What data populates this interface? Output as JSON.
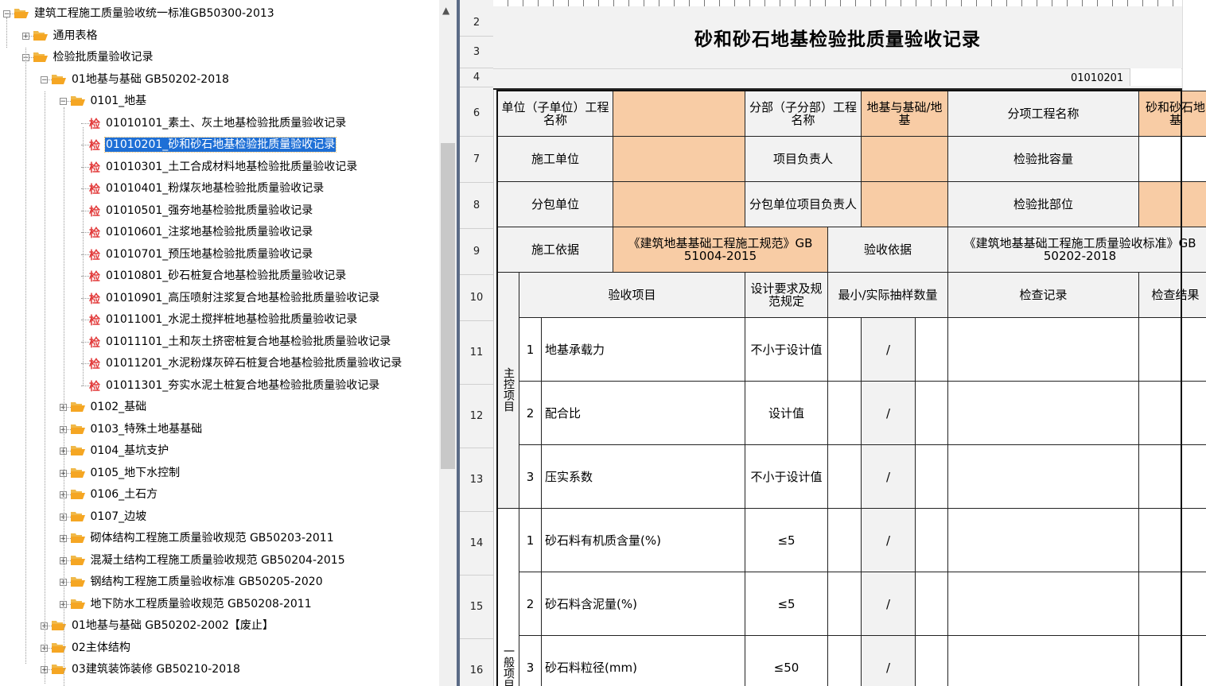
{
  "tree": {
    "items": [
      {
        "label": "建筑工程施工质量验收统一标准GB50300-2013",
        "type": "folder",
        "expander": "−"
      },
      {
        "label": "通用表格",
        "type": "folder",
        "expander": "+"
      },
      {
        "label": "检验批质量验收记录",
        "type": "folder",
        "expander": "−"
      },
      {
        "label": "01地基与基础 GB50202-2018",
        "type": "folder",
        "expander": "−"
      },
      {
        "label": "0101_地基",
        "type": "folder",
        "expander": "−"
      },
      {
        "label": "01010101_素土、灰土地基检验批质量验收记录",
        "type": "doc"
      },
      {
        "label": "01010201_砂和砂石地基检验批质量验收记录",
        "type": "doc",
        "selected": true
      },
      {
        "label": "01010301_土工合成材料地基检验批质量验收记录",
        "type": "doc"
      },
      {
        "label": "01010401_粉煤灰地基检验批质量验收记录",
        "type": "doc"
      },
      {
        "label": "01010501_强夯地基检验批质量验收记录",
        "type": "doc"
      },
      {
        "label": "01010601_注浆地基检验批质量验收记录",
        "type": "doc"
      },
      {
        "label": "01010701_预压地基检验批质量验收记录",
        "type": "doc"
      },
      {
        "label": "01010801_砂石桩复合地基检验批质量验收记录",
        "type": "doc"
      },
      {
        "label": "01010901_高压喷射注浆复合地基检验批质量验收记录",
        "type": "doc"
      },
      {
        "label": "01011001_水泥土搅拌桩地基检验批质量验收记录",
        "type": "doc"
      },
      {
        "label": "01011101_土和灰土挤密桩复合地基检验批质量验收记录",
        "type": "doc"
      },
      {
        "label": "01011201_水泥粉煤灰碎石桩复合地基检验批质量验收记录",
        "type": "doc"
      },
      {
        "label": "01011301_夯实水泥土桩复合地基检验批质量验收记录",
        "type": "doc"
      },
      {
        "label": "0102_基础",
        "type": "folder",
        "expander": "+"
      },
      {
        "label": "0103_特殊土地基基础",
        "type": "folder",
        "expander": "+"
      },
      {
        "label": "0104_基坑支护",
        "type": "folder",
        "expander": "+"
      },
      {
        "label": "0105_地下水控制",
        "type": "folder",
        "expander": "+"
      },
      {
        "label": "0106_土石方",
        "type": "folder",
        "expander": "+"
      },
      {
        "label": "0107_边坡",
        "type": "folder",
        "expander": "+"
      },
      {
        "label": "砌体结构工程施工质量验收规范 GB50203-2011",
        "type": "folder",
        "expander": "+"
      },
      {
        "label": "混凝土结构工程施工质量验收规范 GB50204-2015",
        "type": "folder",
        "expander": "+"
      },
      {
        "label": "钢结构工程施工质量验收标准 GB50205-2020",
        "type": "folder",
        "expander": "+"
      },
      {
        "label": "地下防水工程质量验收规范 GB50208-2011",
        "type": "folder",
        "expander": "+"
      },
      {
        "label": "01地基与基础 GB50202-2002【废止】",
        "type": "folder",
        "expander": "+"
      },
      {
        "label": "02主体结构",
        "type": "folder",
        "expander": "+"
      },
      {
        "label": "03建筑装饰装修 GB50210-2018",
        "type": "folder",
        "expander": "+"
      }
    ],
    "doc_icon_glyph": "检",
    "scroll_up_glyph": "▲"
  },
  "sheet": {
    "row_numbers": [
      "2",
      "3",
      "4",
      "6",
      "7",
      "8",
      "9",
      "10",
      "11",
      "12",
      "13",
      "14",
      "15",
      "16"
    ],
    "title": "砂和砂石地基检验批质量验收记录",
    "code": "01010201",
    "form": {
      "unit_label": "单位（子单位）工程名称",
      "division_label": "分部（子分部）工程名称",
      "division_value": "地基与基础/地基",
      "subitem_label": "分项工程名称",
      "subitem_value": "砂和砂石地基",
      "contractor_label": "施工单位",
      "manager_label": "项目负责人",
      "batch_capacity_label": "检验批容量",
      "subcontractor_label": "分包单位",
      "sub_manager_label": "分包单位项目负责人",
      "batch_location_label": "检验批部位",
      "basis_label": "施工依据",
      "basis_value": "《建筑地基基础工程施工规范》GB 51004-2015",
      "acceptance_basis_label": "验收依据",
      "acceptance_basis_value": "《建筑地基基础工程施工质量验收标准》GB 50202-2018",
      "header_item": "验收项目",
      "header_requirement": "设计要求及规范规定",
      "header_sample": "最小/实际抽样数量",
      "header_record": "检查记录",
      "header_result": "检查结果",
      "main_group": "主控项目",
      "general_group": "一般项目",
      "main_items": [
        {
          "no": "1",
          "name": "地基承载力",
          "req": "不小于设计值",
          "slash": "/"
        },
        {
          "no": "2",
          "name": "配合比",
          "req": "设计值",
          "slash": "/"
        },
        {
          "no": "3",
          "name": "压实系数",
          "req": "不小于设计值",
          "slash": "/"
        }
      ],
      "general_items": [
        {
          "no": "1",
          "name": "砂石料有机质含量(%)",
          "req": "≤5",
          "slash": "/"
        },
        {
          "no": "2",
          "name": "砂石料含泥量(%)",
          "req": "≤5",
          "slash": "/"
        },
        {
          "no": "3",
          "name": "砂石料粒径(mm)",
          "req": "≤50",
          "slash": "/"
        }
      ]
    },
    "colors": {
      "peach": "#f8cca5",
      "header_gray": "#f2f2f2",
      "selection": "#1e6fd6"
    }
  }
}
